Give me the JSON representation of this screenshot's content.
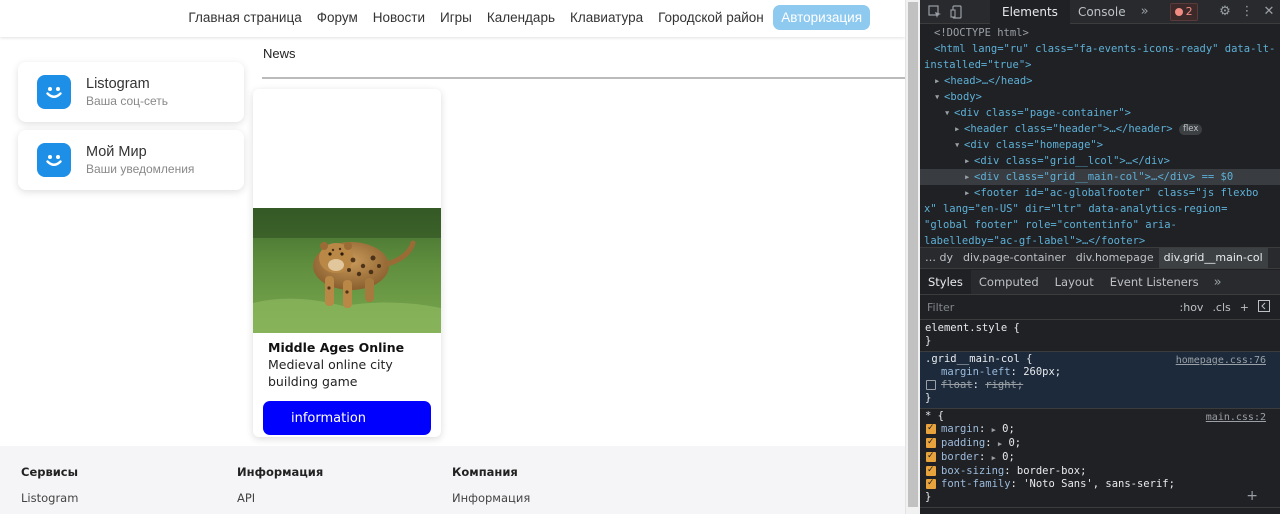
{
  "header": {
    "nav": [
      "Главная страница",
      "Форум",
      "Новости",
      "Игры",
      "Календарь",
      "Клавиатура",
      "Городской район"
    ],
    "auth_button": "Авторизация"
  },
  "sidebar": {
    "cards": [
      {
        "title": "Listogram",
        "subtitle": "Ваша соц-сеть"
      },
      {
        "title": "Мой Мир",
        "subtitle": "Ваши уведомления"
      }
    ]
  },
  "news": {
    "title": "News",
    "card": {
      "name": "Middle Ages Online",
      "description": "Medieval online city building game",
      "button": "information"
    }
  },
  "footer": {
    "columns": [
      {
        "heading": "Сервисы",
        "item": "Listogram"
      },
      {
        "heading": "Информация",
        "item": "API"
      },
      {
        "heading": "Компания",
        "item": "Информация"
      }
    ]
  },
  "devtools": {
    "tabs": [
      "Elements",
      "Console"
    ],
    "error_count": "2",
    "dom_lines": [
      "<!DOCTYPE html>",
      "<html lang=\"ru\" class=\"fa-events-icons-ready\" data-lt-",
      "installed=\"true\">",
      "<head>…</head>",
      "<body>",
      "<div class=\"page-container\">",
      "<header class=\"header\">…</header>",
      "<div class=\"homepage\">",
      "<div class=\"grid__lcol\">…</div>",
      "<div class=\"grid__main-col\">…</div> == $0",
      "<footer id=\"ac-globalfooter\" class=\"js flexbo",
      "x\" lang=\"en-US\" dir=\"ltr\" data-analytics-region=",
      "\"global footer\" role=\"contentinfo\" aria-",
      "labelledby=\"ac-gf-label\">…</footer>"
    ],
    "flex_badge": "flex",
    "breadcrumbs": [
      "…  dy",
      "div.page-container",
      "div.homepage",
      "div.grid__main-col"
    ],
    "style_tabs": [
      "Styles",
      "Computed",
      "Layout",
      "Event Listeners"
    ],
    "filter_placeholder": "Filter",
    "filter_tools": [
      ":hov",
      ".cls"
    ],
    "rules": {
      "element_style": "element.style {",
      "close": "}",
      "main_col_selector": ".grid__main-col {",
      "main_col_source": "homepage.css:76",
      "margin_left_name": "margin-left",
      "margin_left_value": "260px;",
      "float_name": "float",
      "float_value": "right;",
      "universal_selector": "* {",
      "universal_source": "main.css:2",
      "decls": [
        {
          "name": "margin",
          "value": "0;"
        },
        {
          "name": "padding",
          "value": "0;"
        },
        {
          "name": "border",
          "value": "0;"
        },
        {
          "name": "box-sizing",
          "value": "border-box;"
        },
        {
          "name": "font-family",
          "value": "'Noto Sans', sans-serif;"
        }
      ]
    }
  }
}
